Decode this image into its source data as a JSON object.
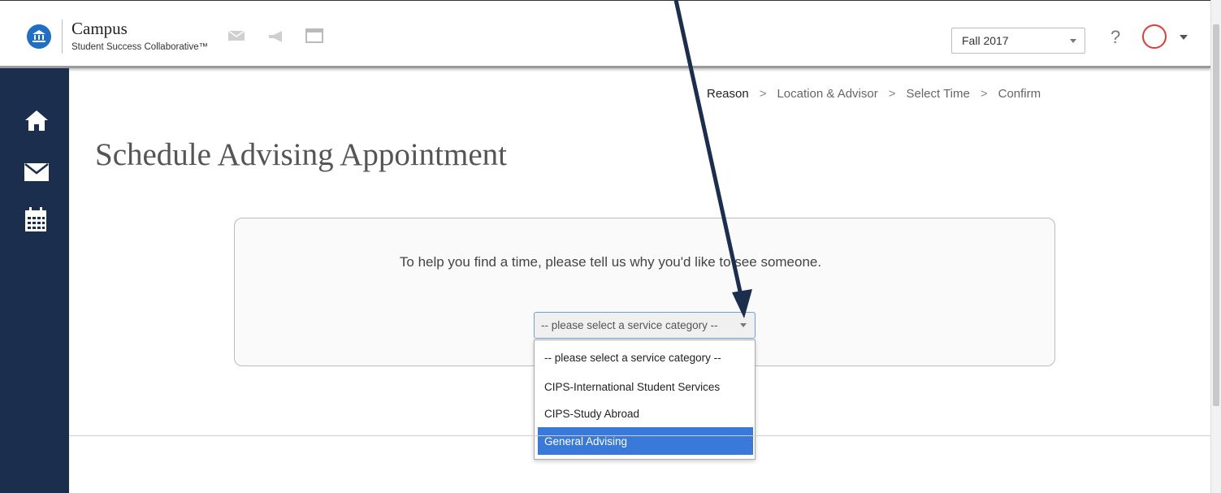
{
  "header": {
    "brand_name": "Campus",
    "brand_sub": "Student Success Collaborative™",
    "term_value": "Fall 2017",
    "help_label": "?"
  },
  "breadcrumb": {
    "steps": [
      "Reason",
      "Location & Advisor",
      "Select Time",
      "Confirm"
    ],
    "separator": ">"
  },
  "main": {
    "title": "Schedule Advising Appointment",
    "prompt": "To help you find a time, please tell us why you'd like to see someone.",
    "service_select": {
      "value": "-- please select a service category --",
      "options": [
        "-- please select a service category --",
        "CIPS-International Student Services",
        "CIPS-Study Abroad",
        "General Advising"
      ],
      "highlighted_index": 3
    }
  },
  "sidebar": {
    "items": [
      "home-icon",
      "mail-icon",
      "calendar-icon"
    ]
  },
  "colors": {
    "sidebar": "#1c2e4d",
    "accent": "#1f6fc5",
    "highlight": "#3879d9",
    "annotation_arrow": "#1c2e4d"
  }
}
